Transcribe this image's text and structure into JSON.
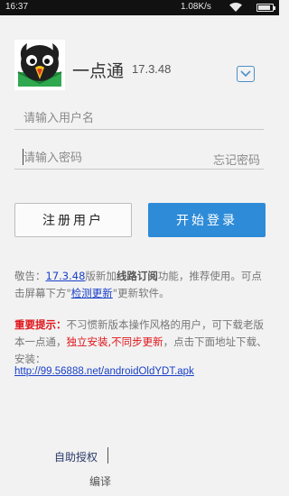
{
  "status_bar": {
    "time": "16:37",
    "net_speed": "1.08K/s",
    "battery_level": 0.85,
    "text_color": "#e8e8e8"
  },
  "header": {
    "app_name": "一点通",
    "version": "17.3.48",
    "logo_icon": "parrot-logo-icon",
    "dropdown_icon": "chevron-down-box-icon"
  },
  "form": {
    "username_placeholder": "请输入用户名",
    "password_placeholder": "请输入密码",
    "forgot_password": "忘记密码",
    "register_label": "注册用户",
    "login_label": "开始登录"
  },
  "notice": {
    "prefix": "敬告：",
    "version_link": "17.3.48",
    "part1": "版新加",
    "feature": "线路订阅",
    "part2": "功能，推荐使用。可点击屏幕下方\"",
    "check_update_link": "检测更新",
    "part3": "\"更新软件。"
  },
  "important": {
    "label": "重要提示：",
    "part1": "不习惯新版本操作风格的用户，可下载老版本一点通，",
    "emphasis": "独立安装,不同步更新",
    "part2": "，点击下面地址下载、安装：",
    "url": "http://99.56888.net/androidOldYDT.apk"
  },
  "footer": {
    "auth_label": "自助授权",
    "translate_label": "编译"
  },
  "colors": {
    "accent_blue": "#2e8bd8",
    "link_blue": "#1a40c8",
    "warning_red": "#e0151b",
    "background": "#f2f2f2"
  }
}
